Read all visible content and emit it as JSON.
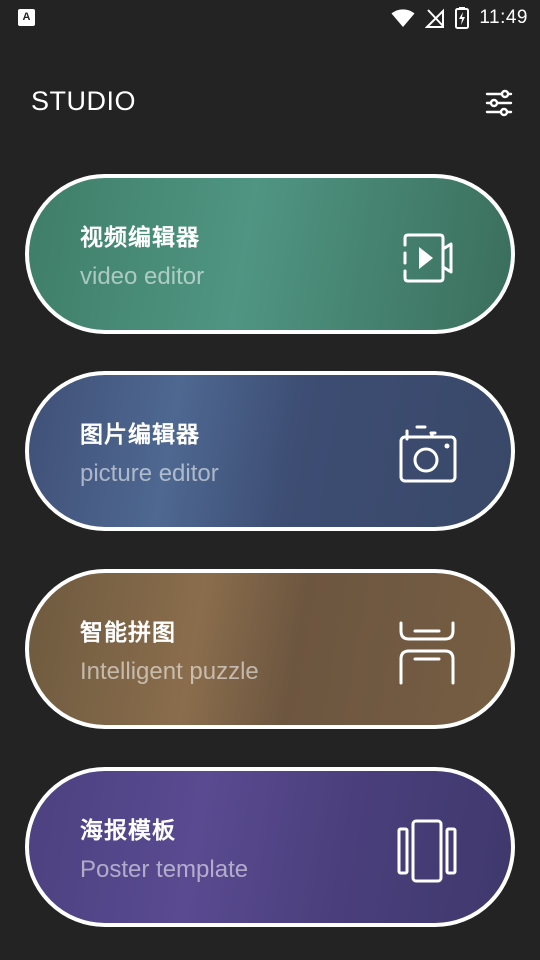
{
  "status_bar": {
    "left_icon_letter": "A",
    "time": "11:49",
    "icons": [
      "notification-app-icon",
      "wifi-icon",
      "no-signal-icon",
      "battery-charging-icon"
    ]
  },
  "header": {
    "title": "STUDIO",
    "settings_icon": "sliders-icon"
  },
  "cards": [
    {
      "title": "视频编辑器",
      "subtitle": "video editor",
      "icon": "video-camera-icon",
      "color": "#4f9582"
    },
    {
      "title": "图片编辑器",
      "subtitle": "picture editor",
      "icon": "photo-camera-icon",
      "color": "#4e6891"
    },
    {
      "title": "智能拼图",
      "subtitle": "Intelligent puzzle",
      "icon": "collage-icon",
      "color": "#8a6d4c"
    },
    {
      "title": "海报模板",
      "subtitle": "Poster template",
      "icon": "poster-carousel-icon",
      "color": "#5a4a91"
    }
  ]
}
